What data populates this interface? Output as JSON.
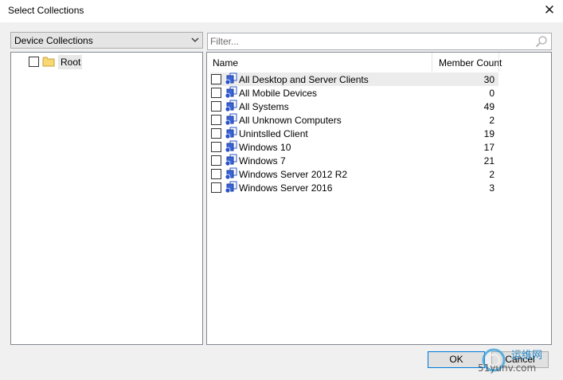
{
  "window": {
    "title": "Select Collections",
    "close_label": "✕"
  },
  "combo": {
    "value": "Device Collections"
  },
  "tree": {
    "root_label": "Root"
  },
  "filter": {
    "placeholder": "Filter..."
  },
  "list": {
    "columns": {
      "name": "Name",
      "member_count": "Member Count"
    },
    "rows": [
      {
        "name": "All Desktop and Server Clients",
        "count": "30"
      },
      {
        "name": "All Mobile Devices",
        "count": "0"
      },
      {
        "name": "All Systems",
        "count": "49"
      },
      {
        "name": "All Unknown Computers",
        "count": "2"
      },
      {
        "name": "Unintslled Client",
        "count": "19"
      },
      {
        "name": "Windows 10",
        "count": "17"
      },
      {
        "name": "Windows 7",
        "count": "21"
      },
      {
        "name": "Windows Server 2012 R2",
        "count": "2"
      },
      {
        "name": "Windows Server 2016",
        "count": "3"
      }
    ]
  },
  "buttons": {
    "ok": "OK",
    "cancel": "Cancel"
  },
  "watermark": {
    "line1": "运维网",
    "line2": "51yunv.com"
  },
  "colors": {
    "accent": "#0078d7",
    "collection_icon": "#2a54c8"
  },
  "icons": {
    "close": "close-icon",
    "dropdown": "chevron-down-icon",
    "search": "search-icon",
    "folder": "folder-icon",
    "collection": "collection-icon"
  }
}
